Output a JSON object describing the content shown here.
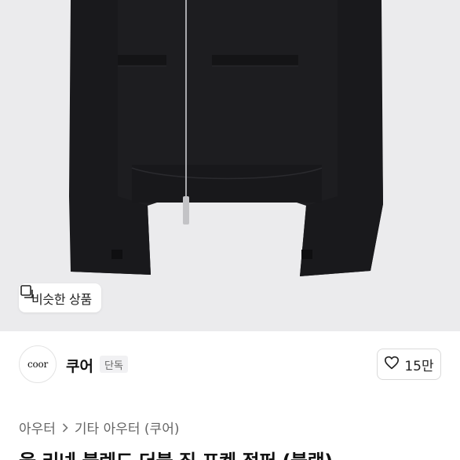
{
  "hero": {
    "image_subject": "black-zip-jacket",
    "similar_button_label": "비슷한 상품",
    "similar_icon": "similar-items-icon"
  },
  "seller": {
    "avatar_text": "coor",
    "name": "쿠어",
    "badge": "단독",
    "like_count": "15만",
    "like_icon": "heart-icon"
  },
  "breadcrumb": {
    "items": [
      "아우터",
      "기타 아우터 (쿠어)"
    ],
    "separator_icon": "chevron-right-icon"
  },
  "product": {
    "title": "울 리넨 블렌드 더블 집 포켓 점퍼 (블랙)"
  },
  "colors": {
    "hero_bg": "#ebebed",
    "jacket": "#1d1d20",
    "text_primary": "#111111",
    "text_secondary": "#666666"
  }
}
